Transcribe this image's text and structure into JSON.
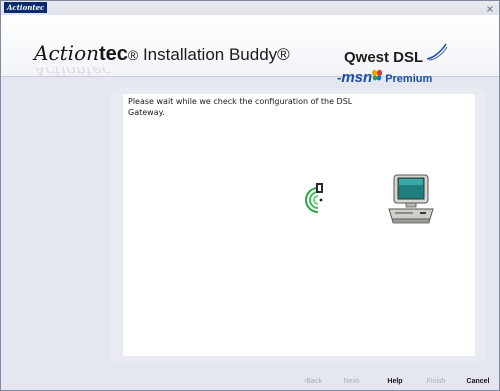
{
  "titlebar": {
    "logo_text": "Actiontec",
    "close_glyph": "×"
  },
  "banner": {
    "brand_script": "Action",
    "brand_tec": "tec",
    "brand_reg": "®",
    "product_name": " Installation Buddy®",
    "reflection_text": "Actiontec",
    "partner": {
      "qwest": "Qwest DSL",
      "msn_dash": "-",
      "msn": "msn",
      "premium": "Premium"
    }
  },
  "content": {
    "message": "Please wait while we check the configuration of the DSL Gateway."
  },
  "icons": {
    "signal": "wireless-signal-icon",
    "computer": "computer-icon"
  },
  "footer": {
    "back": "‹Back",
    "next": "Next›",
    "help": "Help",
    "finish": "Finish",
    "cancel": "Cancel"
  },
  "colors": {
    "accent_blue": "#1c4fa6",
    "title_logo_bg": "#0b2a6e",
    "signal_green": "#2fa84a",
    "panel_bg": "#e4e7ef"
  }
}
